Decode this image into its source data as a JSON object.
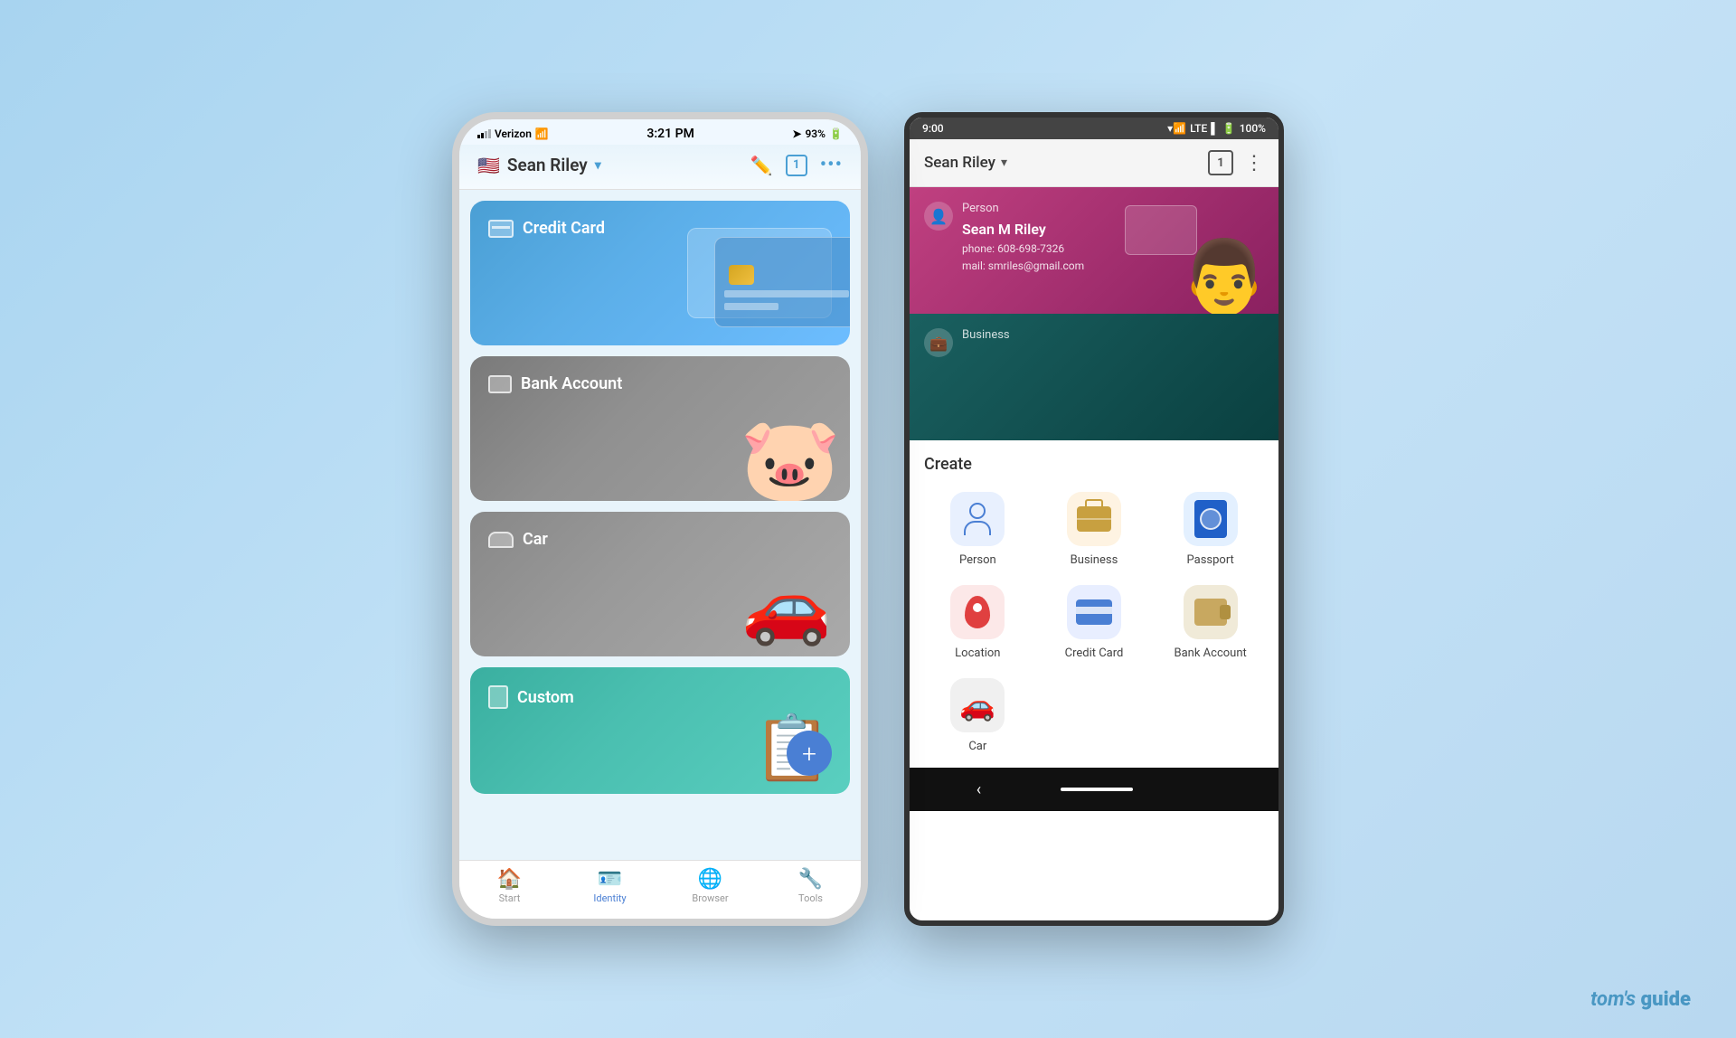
{
  "page": {
    "background": "#b8d8f0",
    "watermark": "tom's guide"
  },
  "ios_phone": {
    "status_bar": {
      "carrier": "Verizon",
      "time": "3:21 PM",
      "battery": "93%"
    },
    "header": {
      "flag": "🇺🇸",
      "user_name": "Sean Riley",
      "dropdown_indicator": "▾"
    },
    "cards": [
      {
        "id": "credit-card",
        "label": "Credit Card",
        "color": "blue"
      },
      {
        "id": "bank-account",
        "label": "Bank Account",
        "color": "gray"
      },
      {
        "id": "car",
        "label": "Car",
        "color": "gray2"
      },
      {
        "id": "custom",
        "label": "Custom",
        "color": "teal"
      }
    ],
    "bottom_nav": [
      {
        "id": "start",
        "label": "Start",
        "icon": "🏠",
        "active": false
      },
      {
        "id": "identity",
        "label": "Identity",
        "icon": "🪪",
        "active": true
      },
      {
        "id": "browser",
        "label": "Browser",
        "icon": "🌐",
        "active": false
      },
      {
        "id": "tools",
        "label": "Tools",
        "icon": "🔧",
        "active": false
      }
    ]
  },
  "android_phone": {
    "status_bar": {
      "time": "9:00",
      "battery": "100%",
      "signal": "LTE"
    },
    "header": {
      "user_name": "Sean Riley"
    },
    "profile_cards": [
      {
        "type": "Person",
        "name": "Sean M Riley",
        "phone": "phone: 608-698-7326",
        "email": "mail: smriles@gmail.com"
      },
      {
        "type": "Business",
        "name": ""
      }
    ],
    "create_section": {
      "title": "Create",
      "items": [
        {
          "id": "person",
          "label": "Person",
          "icon_type": "person"
        },
        {
          "id": "business",
          "label": "Business",
          "icon_type": "business"
        },
        {
          "id": "passport",
          "label": "Passport",
          "icon_type": "passport"
        },
        {
          "id": "location",
          "label": "Location",
          "icon_type": "location"
        },
        {
          "id": "credit-card",
          "label": "Credit Card",
          "icon_type": "credit"
        },
        {
          "id": "bank-account",
          "label": "Bank Account",
          "icon_type": "bank"
        },
        {
          "id": "car",
          "label": "Car",
          "icon_type": "car"
        }
      ]
    }
  }
}
